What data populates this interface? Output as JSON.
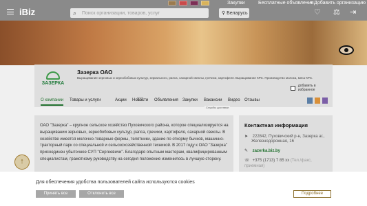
{
  "header": {
    "logo": "iBiz",
    "search_placeholder": "Поиск организации, товаров, услуг",
    "region": "Беларусь",
    "links": {
      "purchases": "Закупки",
      "free_ads": "Бесплатные объявления",
      "add_org": "+ Добавить организацию"
    },
    "flags": [
      "#9b7b4f",
      "#c94b4b",
      "#7c2f55",
      "#d9b35a"
    ]
  },
  "company": {
    "name": "Зазерка ОАО",
    "logo_text": "ЗАЗЕРКА",
    "description": "Выращивание зерновых и зернобобовых культур, зеркального, рапса, сахарной свеклы, гречихи, картофеля. Выращивание КРС. Производство молока, мяса КРС.",
    "favorite": "добавить в избранное"
  },
  "tabs": [
    {
      "label": "О компании",
      "active": true
    },
    {
      "label": "Товары и услуги"
    },
    {
      "label": "Акции"
    },
    {
      "label": "Новости"
    },
    {
      "label": "Объявления"
    },
    {
      "label": "Закупки"
    },
    {
      "label": "Вакансии"
    },
    {
      "label": "Видео"
    },
    {
      "label": "Отзывы"
    }
  ],
  "badge": "12",
  "subtab": "Службы доставки",
  "about": "ОАО \"Зазерка\" – крупное сельское хозяйство Пуховичского района, которое специализируется на выращивании зерновых, зернобобовых культур, рапса, гречихи, картофеля, сахарной свеклы. В хозяйстве имеется молочно-товарные фермы, телятники, здание по откорму бычков, машинно-тракторный парк со специальной и сельскохозяйственной техникой. В 2017 году к ОАО \"Зазерка\" присоединен убыточное СУП \"Сергеевичи\". Благодаря опытным мастерам, квалифицированным специалистам, грамотному руководству на сегодня положение изменилось в лучшую сторону.",
  "contacts": {
    "title": "Контактная информация",
    "address_1": "222842, Пуховичский р-н, Зазерка аг.,",
    "address_2": "Железнодорожная, 16",
    "site": "zazerka.biz.by",
    "phone": "+375 (1713) 7 85 xx",
    "phone_hint_1": "(Тел./факс,",
    "phone_hint_2": "приемная)"
  },
  "cookie": {
    "text": "Для обеспечения удобства пользователей сайта используются cookies",
    "accept": "Принять все",
    "decline": "Отклонить все",
    "more": "Подробнее"
  },
  "social_colors": [
    "#5c7fa6",
    "#d9903a",
    "#7b5ea7"
  ]
}
